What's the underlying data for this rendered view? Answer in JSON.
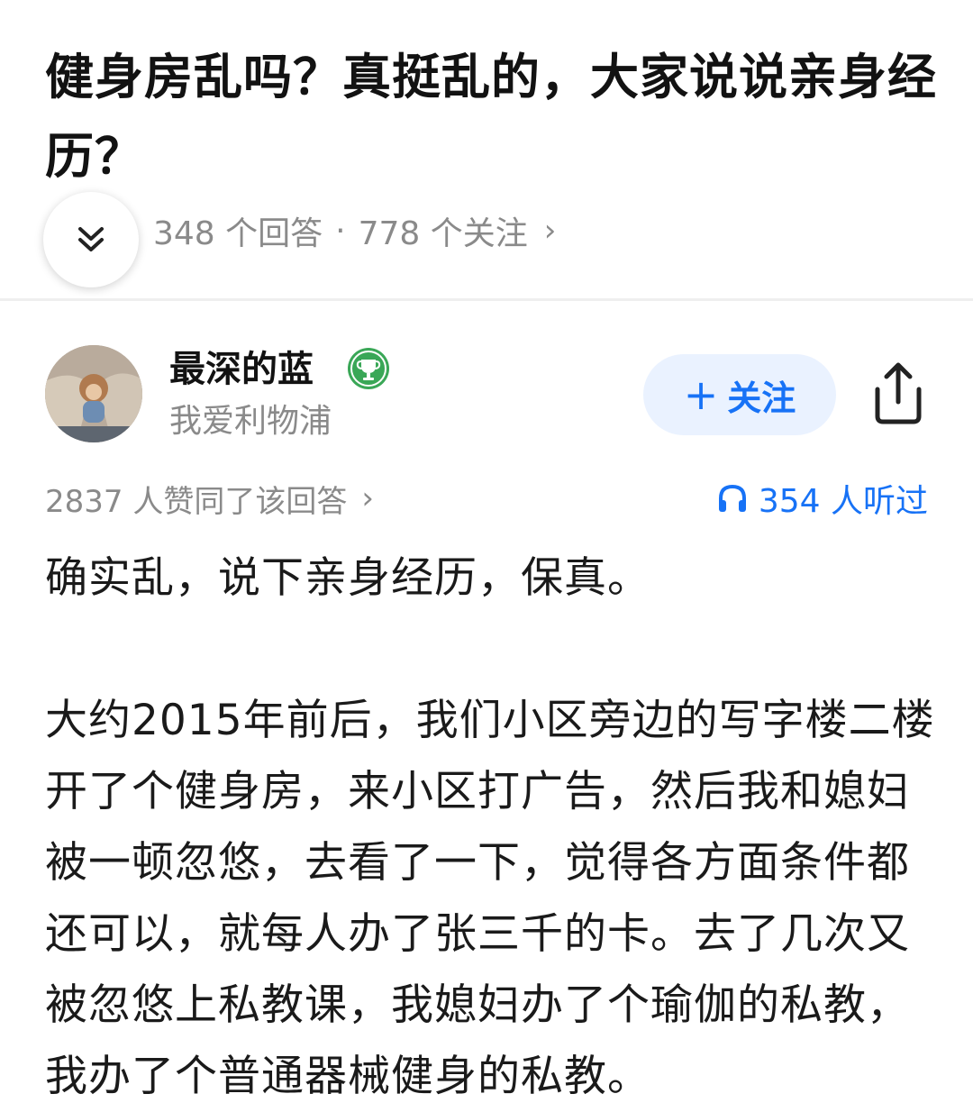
{
  "question": {
    "title": "健身房乱吗？真挺乱的，大家说说亲身经历？",
    "answers_count": "348 个回答",
    "separator": "·",
    "followers_count": "778 个关注",
    "chevron": "›"
  },
  "author": {
    "name": "最深的蓝",
    "bio": "我爱利物浦",
    "follow_label": "关注",
    "follow_plus": "+"
  },
  "meta": {
    "votes": "2837 人赞同了该回答",
    "votes_chevron": "›",
    "listens": "354 人听过"
  },
  "answer": {
    "paragraphs": [
      "确实乱，说下亲身经历，保真。",
      "大约2015年前后，我们小区旁边的写字楼二楼开了个健身房，来小区打广告，然后我和媳妇被一顿忽悠，去看了一下，觉得各方面条件都还可以，就每人办了张三千的卡。去了几次又被忽悠上私教课，我媳妇办了个瑜伽的私教，我办了个普通器械健身的私教。"
    ]
  },
  "colors": {
    "accent": "#1772f6",
    "follow_bg": "#eaf2ff",
    "muted_text": "#8a8a8a",
    "badge_green": "#3aa757"
  },
  "icons": {
    "collapse": "double-chevron-down-icon",
    "badge": "trophy-badge-icon",
    "share": "share-icon",
    "listen": "headphones-icon"
  }
}
